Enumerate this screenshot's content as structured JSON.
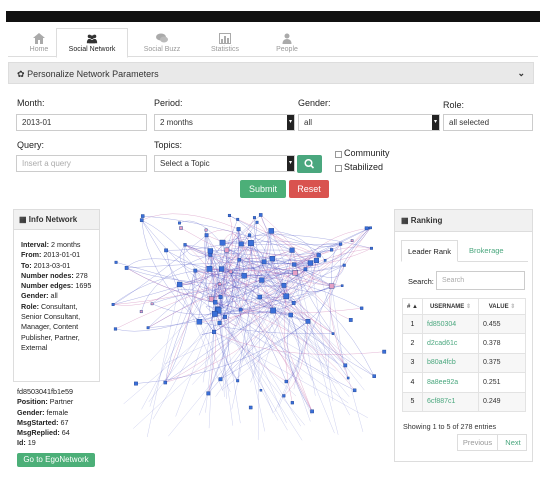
{
  "tabs": [
    {
      "label": "Home",
      "icon": "home-icon"
    },
    {
      "label": "Social Network",
      "icon": "users-icon"
    },
    {
      "label": "Social Buzz",
      "icon": "chat-icon"
    },
    {
      "label": "Statistics",
      "icon": "bar-chart-icon"
    },
    {
      "label": "People",
      "icon": "person-icon"
    }
  ],
  "params_panel": {
    "title": "Personalize Network Parameters"
  },
  "form": {
    "month_label": "Month:",
    "month_value": "2013-01",
    "period_label": "Period:",
    "period_value": "2 months",
    "gender_label": "Gender:",
    "gender_value": "all",
    "role_label": "Role:",
    "role_value": "all selected",
    "query_label": "Query:",
    "query_placeholder": "Insert a query",
    "topics_label": "Topics:",
    "topics_value": "Select a Topic",
    "community_label": "Community",
    "stabilized_label": "Stabilized",
    "submit_label": "Submit",
    "reset_label": "Reset"
  },
  "info": {
    "title": "Info Network",
    "interval_key": "Interval:",
    "interval_val": " 2 months",
    "from_key": "From:",
    "from_val": " 2013-01-01",
    "to_key": "To:",
    "to_val": " 2013-03-01",
    "nodes_key": "Number nodes:",
    "nodes_val": " 278",
    "edges_key": "Number edges:",
    "edges_val": " 1695",
    "gender_key": "Gender:",
    "gender_val": " all",
    "role_key": "Role:",
    "role_val": " Consultant, Senior Consultant, Manager, Content Publisher, Partner, External"
  },
  "node": {
    "id_line": "fd8503041fb1e59",
    "position_key": "Position:",
    "position_val": " Partner",
    "gender_key": "Gender:",
    "gender_val": " female",
    "started_key": "MsgStarted:",
    "started_val": " 67",
    "replied_key": "MsgReplied:",
    "replied_val": " 64",
    "idnum_key": "Id:",
    "idnum_val": " 19",
    "ego_button": "Go to EgoNetwork"
  },
  "ranking": {
    "title": "Ranking",
    "tab_active": "Leader Rank",
    "tab_other": "Brokerage",
    "search_label": "Search:",
    "search_placeholder": "Search",
    "col_num": "#",
    "col_user": "USERNAME",
    "col_value": "VALUE",
    "rows": [
      {
        "n": "1",
        "user": "fd850304",
        "value": "0.455"
      },
      {
        "n": "2",
        "user": "d2cad61c",
        "value": "0.378"
      },
      {
        "n": "3",
        "user": "b80a4fcb",
        "value": "0.375"
      },
      {
        "n": "4",
        "user": "8a8ee92a",
        "value": "0.251"
      },
      {
        "n": "5",
        "user": "6cf887c1",
        "value": "0.249"
      }
    ],
    "showing": "Showing 1 to 5 of 278 entries",
    "prev": "Previous",
    "next": "Next"
  },
  "colors": {
    "accent": "#4aa77e",
    "danger": "#d9534f",
    "node": "#3a6fd8",
    "edge": "#4a52c4",
    "edge_alt": "#c25ca0"
  }
}
